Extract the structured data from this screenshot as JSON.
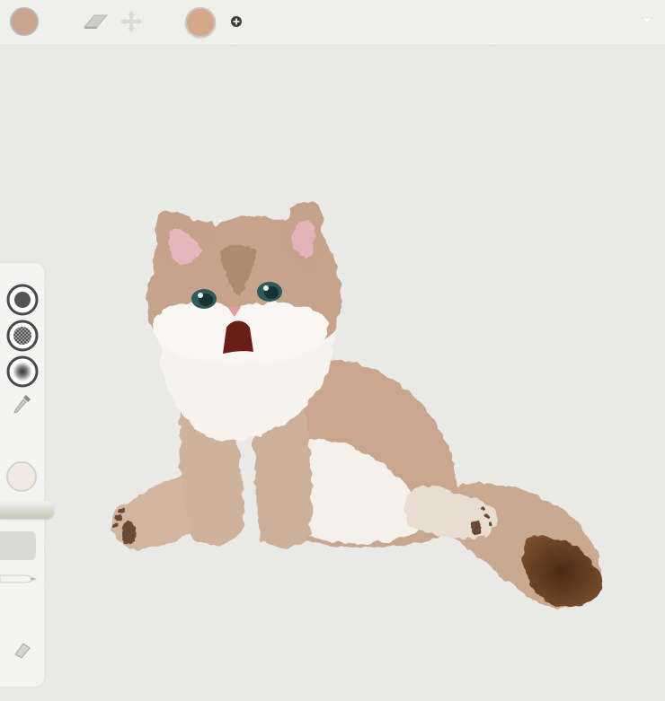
{
  "app": {
    "name": "painting-app"
  },
  "colors": {
    "current_brush_color": "#c9a58f",
    "swatch_color": "#d4a888",
    "paper": "#ebebe9",
    "toolbar_bg": "#eeeeec"
  },
  "toolbar": {
    "left_swatch_icon": "color-swatch-icon",
    "eraser_icon": "eraser-icon",
    "move_icon": "move-arrows-icon",
    "swatch_icon": "color-swatch-icon",
    "add_icon": "plus-circle-icon",
    "menu_icon": "chevron-down-icon"
  },
  "sidebar": {
    "tools": [
      {
        "icon": "brush-solid-icon"
      },
      {
        "icon": "brush-texture-icon"
      },
      {
        "icon": "brush-soft-icon"
      },
      {
        "icon": "eyedropper-icon"
      },
      {
        "icon": "color-circle-icon"
      },
      {
        "icon": "size-slider-icon"
      },
      {
        "icon": "opacity-slider-icon"
      },
      {
        "icon": "pencil-icon"
      },
      {
        "icon": "eraser-icon"
      }
    ],
    "opacity_label": ""
  }
}
